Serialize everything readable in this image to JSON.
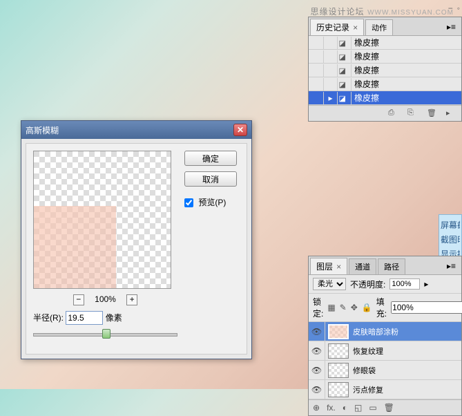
{
  "watermark": {
    "text": "思缘设计论坛",
    "url": "WWW.MISSYUAN.COM"
  },
  "dialog": {
    "title": "高斯模糊",
    "ok": "确定",
    "cancel": "取消",
    "preview_label": "预览(P)",
    "zoom_pct": "100%",
    "zoom_out": "−",
    "zoom_in": "+",
    "radius_label": "半径(R):",
    "radius_value": "19.5",
    "radius_unit": "像素"
  },
  "history": {
    "tabs": [
      "历史记录",
      "动作"
    ],
    "close_x": "×",
    "items": [
      {
        "label": "橡皮擦",
        "sel": false
      },
      {
        "label": "橡皮擦",
        "sel": false
      },
      {
        "label": "橡皮擦",
        "sel": false
      },
      {
        "label": "橡皮擦",
        "sel": false
      },
      {
        "label": "橡皮擦",
        "sel": true
      }
    ],
    "footer_icons": [
      "⎙",
      "⎘",
      "🗑",
      "▸"
    ]
  },
  "info": {
    "rows": [
      "屏幕截",
      "截图时",
      "显示提"
    ]
  },
  "layers": {
    "tabs": [
      "图层",
      "通道",
      "路径"
    ],
    "blend_mode": "柔光",
    "opacity_label": "不透明度:",
    "opacity_value": "100%",
    "lock_label": "锁定:",
    "lock_icons": [
      "▦",
      "✎",
      "✥",
      "🔒"
    ],
    "fill_label": "填充:",
    "fill_value": "100%",
    "items": [
      {
        "name": "皮肤暗部涂粉",
        "sel": true,
        "skin": true
      },
      {
        "name": "恢复纹理",
        "sel": false,
        "skin": false
      },
      {
        "name": "修眼袋",
        "sel": false,
        "skin": false
      },
      {
        "name": "污点修复",
        "sel": false,
        "skin": false
      }
    ],
    "footer_icons": [
      "⊕",
      "fx.",
      "◐",
      "◱",
      "▭",
      "🗑"
    ]
  }
}
